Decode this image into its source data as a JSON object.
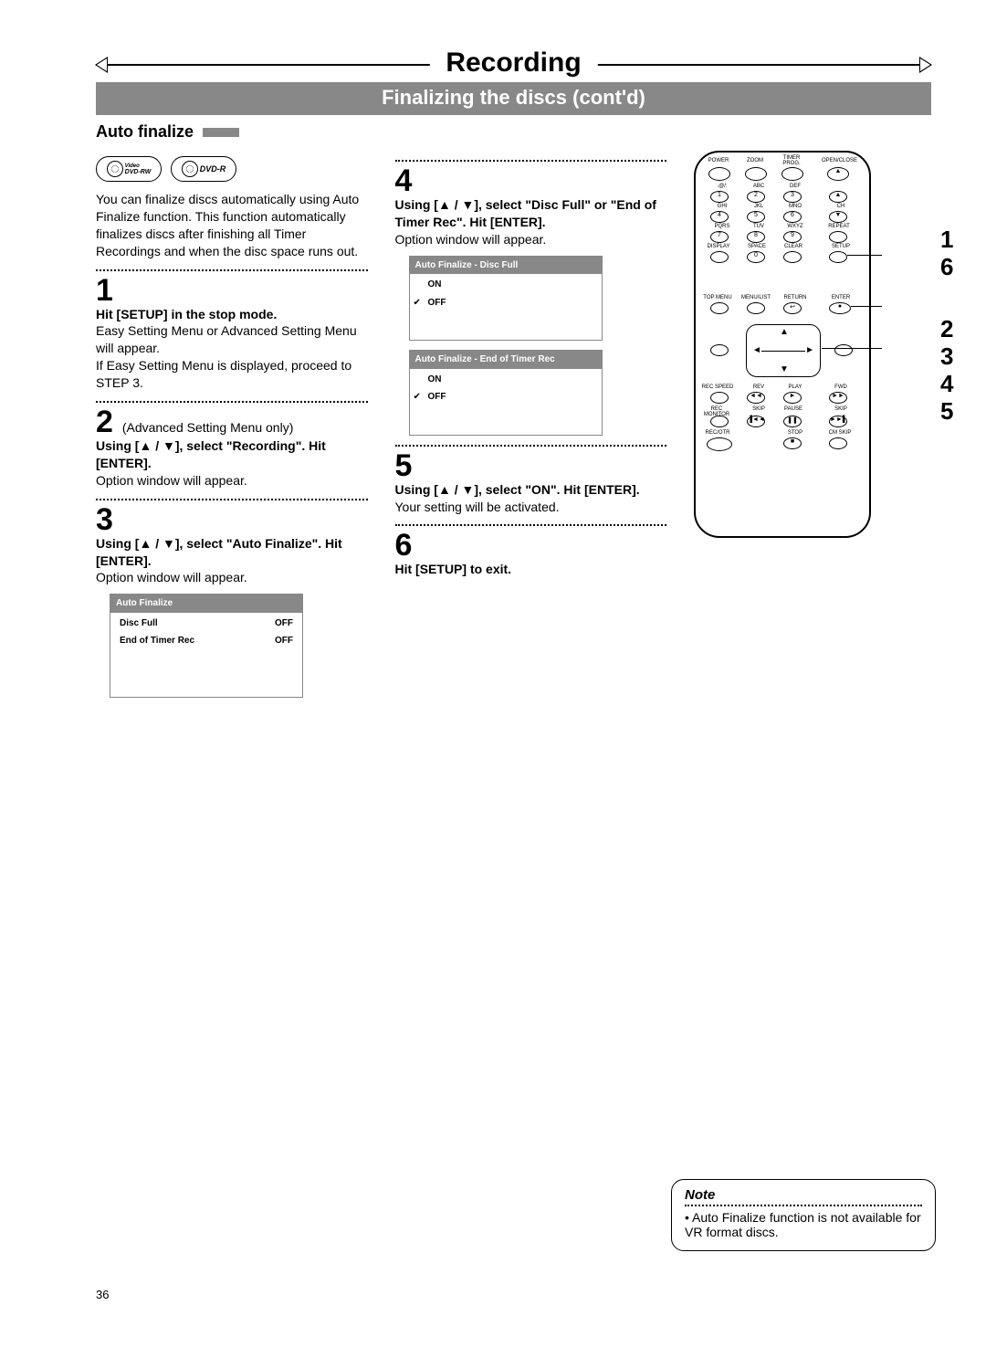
{
  "header": {
    "main_title": "Recording",
    "sub_title": "Finalizing the discs (cont'd)",
    "section_title": "Auto finalize"
  },
  "disc_icons": [
    "DVD-RW",
    "DVD-R"
  ],
  "intro_text": "You can finalize discs automatically using Auto Finalize function. This function automatically finalizes discs after finishing all Timer Recordings and when the disc space runs out.",
  "steps": {
    "s1": {
      "num": "1",
      "bold": "Hit [SETUP] in the stop mode.",
      "text1": "Easy Setting Menu or Advanced Setting Menu will appear.",
      "text2": "If Easy Setting Menu is displayed, proceed to STEP 3."
    },
    "s2": {
      "num": "2",
      "note": "(Advanced Setting Menu only)",
      "bold": "Using [▲ / ▼], select \"Recording\". Hit [ENTER].",
      "text1": "Option window will appear."
    },
    "s3": {
      "num": "3",
      "bold": "Using [▲ / ▼], select \"Auto Finalize\". Hit [ENTER].",
      "text1": "Option window will appear."
    },
    "s4": {
      "num": "4",
      "bold": "Using [▲ / ▼], select \"Disc Full\" or \"End of Timer Rec\". Hit [ENTER].",
      "text1": "Option window will appear."
    },
    "s5": {
      "num": "5",
      "bold": "Using [▲ / ▼], select \"ON\". Hit [ENTER].",
      "text1": "Your setting will be activated."
    },
    "s6": {
      "num": "6",
      "bold": "Hit [SETUP] to exit."
    }
  },
  "osd": {
    "auto_finalize": {
      "title": "Auto Finalize",
      "rows": [
        {
          "label": "Disc Full",
          "value": "OFF"
        },
        {
          "label": "End of Timer Rec",
          "value": "OFF"
        }
      ]
    },
    "disc_full": {
      "title": "Auto Finalize - Disc Full",
      "rows": [
        {
          "label": "ON",
          "checked": false
        },
        {
          "label": "OFF",
          "checked": true
        }
      ]
    },
    "end_timer": {
      "title": "Auto Finalize - End of Timer Rec",
      "rows": [
        {
          "label": "ON",
          "checked": false
        },
        {
          "label": "OFF",
          "checked": true
        }
      ]
    }
  },
  "remote": {
    "top_labels": [
      "POWER",
      "ZOOM",
      "TIMER PROG.",
      "OPEN/CLOSE"
    ],
    "num_rows": [
      [
        ".@/:",
        "ABC",
        "DEF",
        ""
      ],
      [
        "1",
        "2",
        "3",
        "▲"
      ],
      [
        "GHI",
        "JKL",
        "MNO",
        "CH"
      ],
      [
        "4",
        "5",
        "6",
        "▼"
      ],
      [
        "PQRS",
        "TUV",
        "WXYZ",
        "REPEAT"
      ],
      [
        "7",
        "8",
        "9",
        ""
      ],
      [
        "DISPLAY",
        "SPACE",
        "CLEAR",
        "SETUP"
      ],
      [
        "",
        "0",
        "",
        ""
      ],
      [
        "TOP MENU",
        "MENU/LIST",
        "RETURN",
        "ENTER"
      ]
    ],
    "nav": [
      "▲",
      "▼",
      "◄",
      "►"
    ],
    "transport_labels": [
      "REC SPEED",
      "REV",
      "PLAY",
      "FWD",
      "REC MONITOR",
      "SKIP",
      "PAUSE",
      "SKIP",
      "REC/OTR",
      "",
      "STOP",
      "CM SKIP"
    ]
  },
  "callouts": [
    "1",
    "6",
    "2",
    "3",
    "4",
    "5"
  ],
  "note": {
    "title": "Note",
    "text": "• Auto Finalize function is not available for VR format discs."
  },
  "page_number": "36"
}
